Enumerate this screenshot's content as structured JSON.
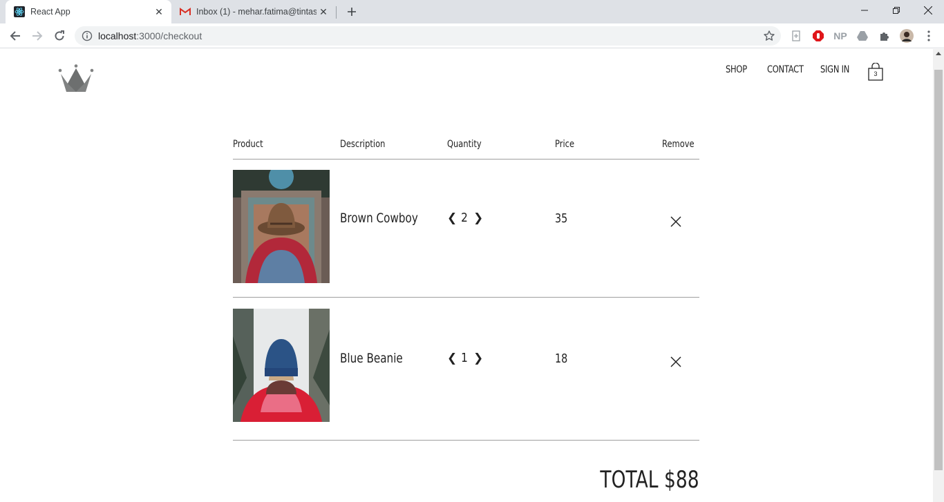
{
  "browser": {
    "tabs": [
      {
        "title": "React App",
        "icon": "react-icon",
        "active": true
      },
      {
        "title": "Inbox (1) - mehar.fatima@tintash",
        "icon": "gmail-icon",
        "active": false
      }
    ],
    "url_host": "localhost",
    "url_path": ":3000/checkout",
    "extensions": {
      "np_label": "NP"
    }
  },
  "header": {
    "nav": {
      "shop": "SHOP",
      "contact": "CONTACT",
      "sign_in": "SIGN IN"
    },
    "cart_count": "3"
  },
  "checkout": {
    "columns": {
      "product": "Product",
      "description": "Description",
      "quantity": "Quantity",
      "price": "Price",
      "remove": "Remove"
    },
    "items": [
      {
        "name": "Brown Cowboy",
        "quantity": "2",
        "price": "35",
        "image": "hat-photo"
      },
      {
        "name": "Blue Beanie",
        "quantity": "1",
        "price": "18",
        "image": "beanie-photo"
      }
    ],
    "total_label": "TOTAL $88"
  },
  "colors": {
    "accent": "#222222",
    "divider": "#9e9e9e",
    "logo": "#808282"
  }
}
